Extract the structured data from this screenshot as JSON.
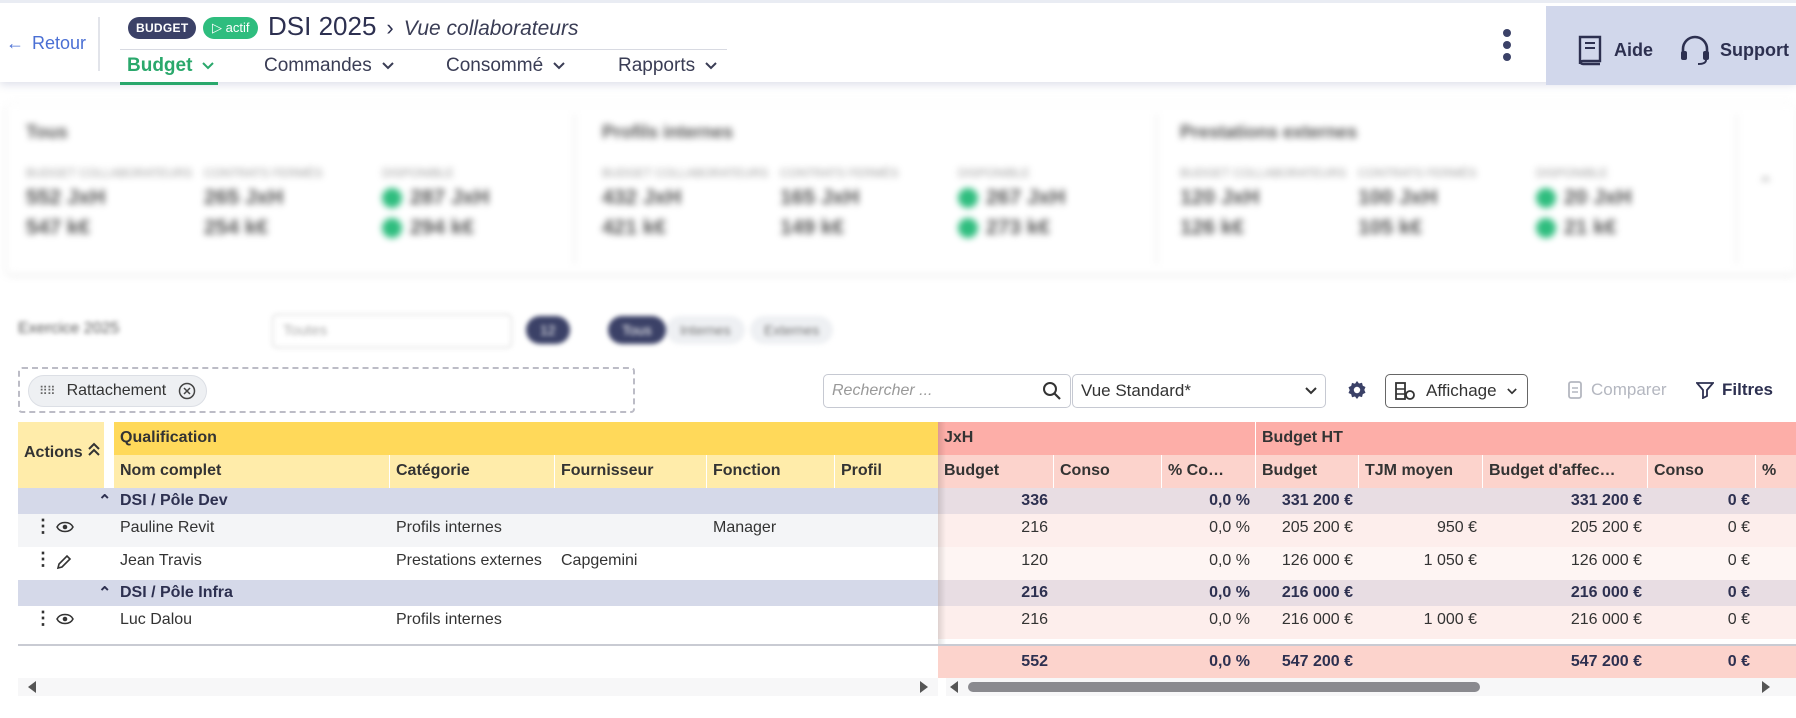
{
  "header": {
    "back_label": "Retour",
    "badge_budget": "BUDGET",
    "badge_actif": "actif",
    "title": "DSI 2025",
    "subtitle": "Vue collaborateurs",
    "tabs": [
      {
        "label": "Budget"
      },
      {
        "label": "Commandes"
      },
      {
        "label": "Consommé"
      },
      {
        "label": "Rapports"
      }
    ],
    "help_label": "Aide",
    "support_label": "Support"
  },
  "stats": [
    {
      "title": "Tous",
      "labels": [
        "BUDGET COLLABORATEURS",
        "CONTRATS FERMÉS",
        "DISPONIBLE"
      ],
      "row1": [
        "552 JxH",
        "265 JxH",
        "287 JxH"
      ],
      "row2": [
        "547 k€",
        "254 k€",
        "294 k€"
      ]
    },
    {
      "title": "Profils internes",
      "labels": [
        "BUDGET COLLABORATEURS",
        "CONTRATS FERMÉS",
        "DISPONIBLE"
      ],
      "row1": [
        "432 JxH",
        "165 JxH",
        "267 JxH"
      ],
      "row2": [
        "421 k€",
        "149 k€",
        "273 k€"
      ]
    },
    {
      "title": "Prestations externes",
      "labels": [
        "BUDGET COLLABORATEURS",
        "CONTRATS FERMÉS",
        "DISPONIBLE"
      ],
      "row1": [
        "120 JxH",
        "100 JxH",
        "20 JxH"
      ],
      "row2": [
        "126 k€",
        "105 k€",
        "21 k€"
      ]
    }
  ],
  "filters": {
    "exercice": "Exercice 2025",
    "select_placeholder": "Toutes",
    "pill_count": "12",
    "segments": [
      "Tous",
      "Internes",
      "Externes"
    ]
  },
  "grouping": {
    "chip_label": "Rattachement"
  },
  "toolbar": {
    "search_placeholder": "Rechercher ...",
    "view_select": "Vue Standard*",
    "affichage_label": "Affichage",
    "comparer_label": "Comparer",
    "filtres_label": "Filtres"
  },
  "grid": {
    "actions_header": "Actions",
    "group_qualification": "Qualification",
    "group_jxh": "JxH",
    "group_budget_ht": "Budget HT",
    "columns": [
      "Nom complet",
      "Catégorie",
      "Fournisseur",
      "Fonction",
      "Profil",
      "Budget",
      "Conso",
      "% Co…",
      "Budget",
      "TJM moyen",
      "Budget d'affec…",
      "Conso",
      "%"
    ],
    "rows": [
      {
        "type": "group",
        "label": "DSI / Pôle Dev",
        "values": [
          "336",
          "",
          "0,0 %",
          "331 200 €",
          "",
          "331 200 €",
          "0 €"
        ]
      },
      {
        "type": "item",
        "icon": "eye-icon",
        "nom": "Pauline Revit",
        "categorie": "Profils internes",
        "fournisseur": "",
        "fonction": "Manager",
        "profil": "",
        "values": [
          "216",
          "",
          "0,0 %",
          "205 200 €",
          "950 €",
          "205 200 €",
          "0 €"
        ]
      },
      {
        "type": "item",
        "icon": "pencil-icon",
        "nom": "Jean Travis",
        "categorie": "Prestations externes",
        "fournisseur": "Capgemini",
        "fonction": "",
        "profil": "",
        "values": [
          "120",
          "",
          "0,0 %",
          "126 000 €",
          "1 050 €",
          "126 000 €",
          "0 €"
        ]
      },
      {
        "type": "group",
        "label": "DSI / Pôle Infra",
        "values": [
          "216",
          "",
          "0,0 %",
          "216 000 €",
          "",
          "216 000 €",
          "0 €"
        ]
      },
      {
        "type": "item",
        "icon": "eye-icon",
        "nom": "Luc Dalou",
        "categorie": "Profils internes",
        "fournisseur": "",
        "fonction": "",
        "profil": "",
        "values": [
          "216",
          "",
          "0,0 %",
          "216 000 €",
          "1 000 €",
          "216 000 €",
          "0 €"
        ]
      }
    ],
    "totals": [
      "552",
      "",
      "0,0 %",
      "547 200 €",
      "",
      "547 200 €",
      "0 €"
    ]
  }
}
